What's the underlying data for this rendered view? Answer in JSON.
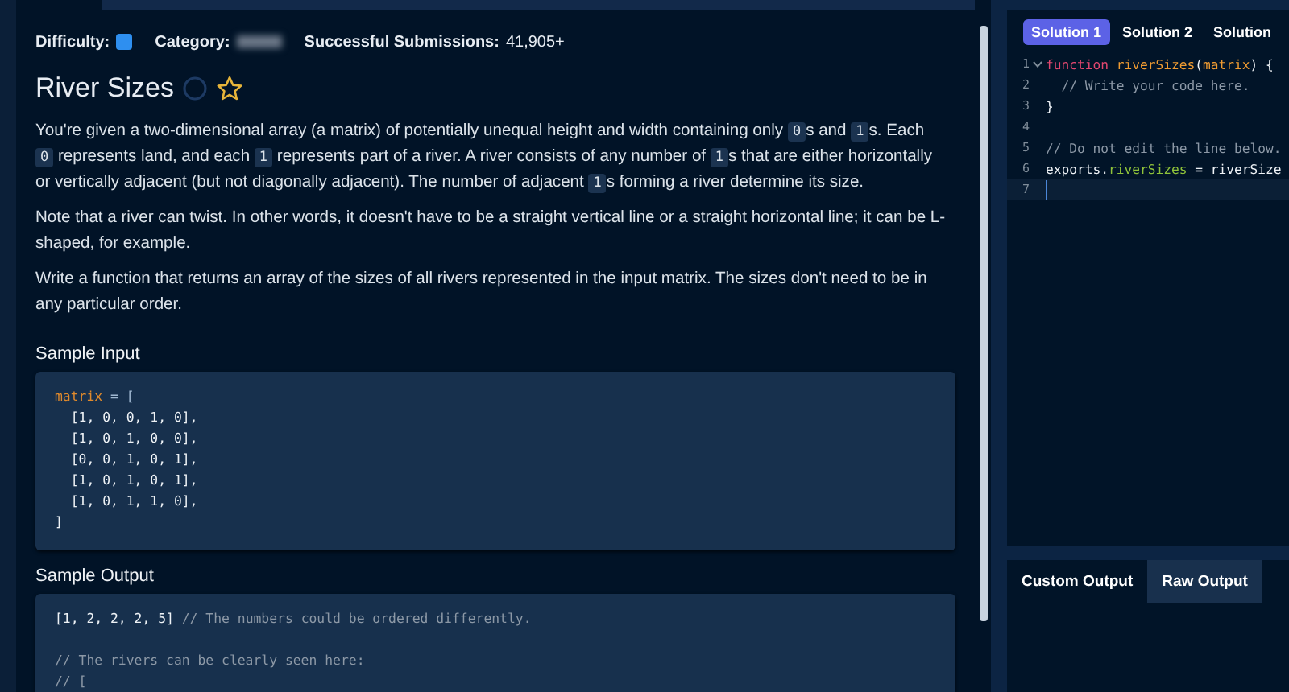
{
  "meta": [
    {
      "label": "Difficulty:",
      "kind": "difficulty"
    },
    {
      "label": "Category:",
      "kind": "hidden"
    },
    {
      "label": "Successful Submissions:",
      "value": "41,905+",
      "kind": "value"
    }
  ],
  "title": {
    "text": "River Sizes",
    "completed": false,
    "starred": false
  },
  "description": [
    {
      "segments": [
        {
          "kind": "text",
          "text": "You're given a two-dimensional array (a matrix) of potentially unequal height and width containing only "
        },
        {
          "kind": "code",
          "text": "0"
        },
        {
          "kind": "text",
          "text": "s and "
        },
        {
          "kind": "code",
          "text": "1"
        },
        {
          "kind": "text",
          "text": "s. Each "
        },
        {
          "kind": "code",
          "text": "0"
        },
        {
          "kind": "text",
          "text": " represents land, and each "
        },
        {
          "kind": "code",
          "text": "1"
        },
        {
          "kind": "text",
          "text": " represents part of a river. A river consists of any number of "
        },
        {
          "kind": "code",
          "text": "1"
        },
        {
          "kind": "text",
          "text": "s that are either horizontally or vertically adjacent (but not diagonally adjacent). The number of adjacent "
        },
        {
          "kind": "code",
          "text": "1"
        },
        {
          "kind": "text",
          "text": "s forming a river determine its size."
        }
      ]
    },
    {
      "segments": [
        {
          "kind": "text",
          "text": "Note that a river can twist. In other words, it doesn't have to be a straight vertical line or a straight horizontal line; it can be L-shaped, for example."
        }
      ]
    },
    {
      "segments": [
        {
          "kind": "text",
          "text": "Write a function that returns an array of the sizes of all rivers represented in the input matrix. The sizes don't need to be in any particular order."
        }
      ]
    }
  ],
  "samples": [
    {
      "heading": "Sample Input",
      "lines": [
        {
          "tokens": [
            {
              "kind": "variable",
              "text": "matrix"
            },
            {
              "kind": "operator",
              "text": " = ["
            }
          ]
        },
        {
          "tokens": [
            {
              "kind": "plain",
              "text": "  [1, 0, 0, 1, 0],"
            }
          ]
        },
        {
          "tokens": [
            {
              "kind": "plain",
              "text": "  [1, 0, 1, 0, 0],"
            }
          ]
        },
        {
          "tokens": [
            {
              "kind": "plain",
              "text": "  [0, 0, 1, 0, 1],"
            }
          ]
        },
        {
          "tokens": [
            {
              "kind": "plain",
              "text": "  [1, 0, 1, 0, 1],"
            }
          ]
        },
        {
          "tokens": [
            {
              "kind": "plain",
              "text": "  [1, 0, 1, 1, 0],"
            }
          ]
        },
        {
          "tokens": [
            {
              "kind": "plain",
              "text": "]"
            }
          ]
        }
      ]
    },
    {
      "heading": "Sample Output",
      "lines": [
        {
          "tokens": [
            {
              "kind": "plain",
              "text": "[1, 2, 2, 2, 5]"
            },
            {
              "kind": "comment",
              "text": " // The numbers could be ordered differently."
            }
          ]
        },
        {
          "space_before": true,
          "tokens": [
            {
              "kind": "comment",
              "text": "// The rivers can be clearly seen here:"
            }
          ]
        },
        {
          "tokens": [
            {
              "kind": "comment",
              "text": "// ["
            }
          ]
        }
      ]
    }
  ],
  "solution_tabs": [
    {
      "label": "Solution 1",
      "selected": true
    },
    {
      "label": "Solution 2",
      "selected": false
    },
    {
      "label": "Solution",
      "selected": false
    }
  ],
  "editor": [
    {
      "number": "1",
      "foldable": true,
      "active": false,
      "tokens": [
        {
          "kind": "keyword",
          "text": "function"
        },
        {
          "kind": "function",
          "text": " riverSizes"
        },
        {
          "kind": "plain",
          "text": "("
        },
        {
          "kind": "function",
          "text": "matrix"
        },
        {
          "kind": "plain",
          "text": ") {"
        }
      ]
    },
    {
      "number": "2",
      "foldable": false,
      "active": false,
      "tokens": [
        {
          "kind": "comment",
          "text": "  // Write your code here."
        }
      ]
    },
    {
      "number": "3",
      "foldable": false,
      "active": false,
      "tokens": [
        {
          "kind": "plain",
          "text": "}"
        }
      ]
    },
    {
      "number": "4",
      "foldable": false,
      "active": false
    },
    {
      "number": "5",
      "foldable": false,
      "active": false,
      "tokens": [
        {
          "kind": "comment",
          "text": "// Do not edit the line below."
        }
      ]
    },
    {
      "number": "6",
      "foldable": false,
      "active": false,
      "tokens": [
        {
          "kind": "plain",
          "text": "exports."
        },
        {
          "kind": "property",
          "text": "riverSizes"
        },
        {
          "kind": "plain",
          "text": " = riverSize"
        }
      ]
    },
    {
      "number": "7",
      "foldable": false,
      "active": true
    }
  ],
  "output_tabs": [
    {
      "label": "Custom Output",
      "selected": true
    },
    {
      "label": "Raw Output",
      "selected": false
    }
  ]
}
